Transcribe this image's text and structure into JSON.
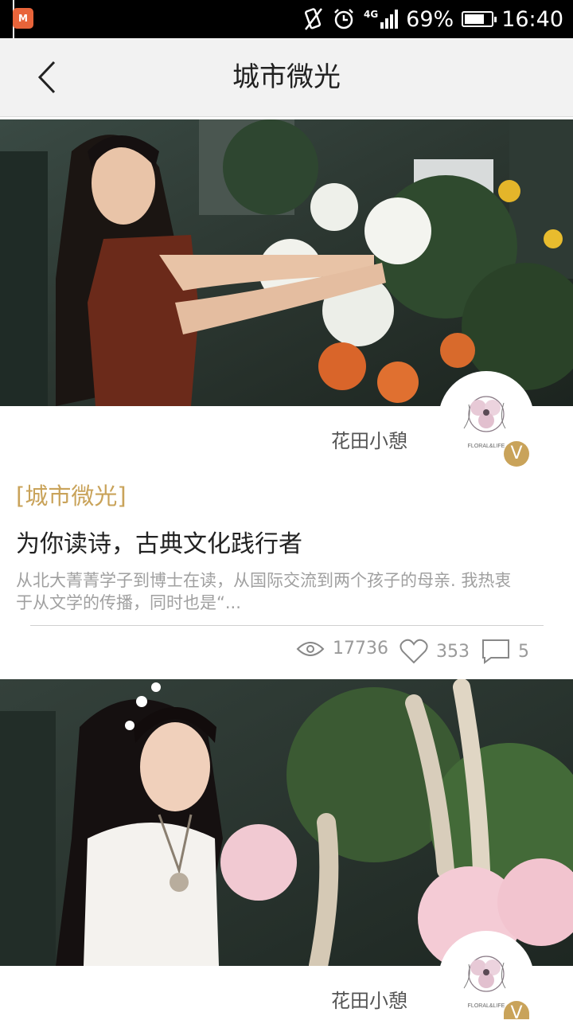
{
  "status_bar": {
    "battery": "69%",
    "time": "16:40",
    "network": "4G",
    "battery_level": 0.69
  },
  "header": {
    "title": "城市微光",
    "back_icon": "chevron-left-icon"
  },
  "articles": [
    {
      "author": "花田小憩",
      "badge": "V",
      "tag": "[城市微光]",
      "title": "为你读诗，古典文化践行者",
      "excerpt": "从北大菁菁学子到博士在读，从国际交流到两个孩子的母亲. 我热衷于从文学的传播，同时也是“...",
      "views": "17736",
      "likes": "353",
      "comments": "5"
    },
    {
      "author": "花田小憩",
      "badge": "V"
    }
  ],
  "colors": {
    "accent_gold": "#c9a35a",
    "header_bg": "#f2f2f2",
    "status_bar_bg": "#000000"
  }
}
